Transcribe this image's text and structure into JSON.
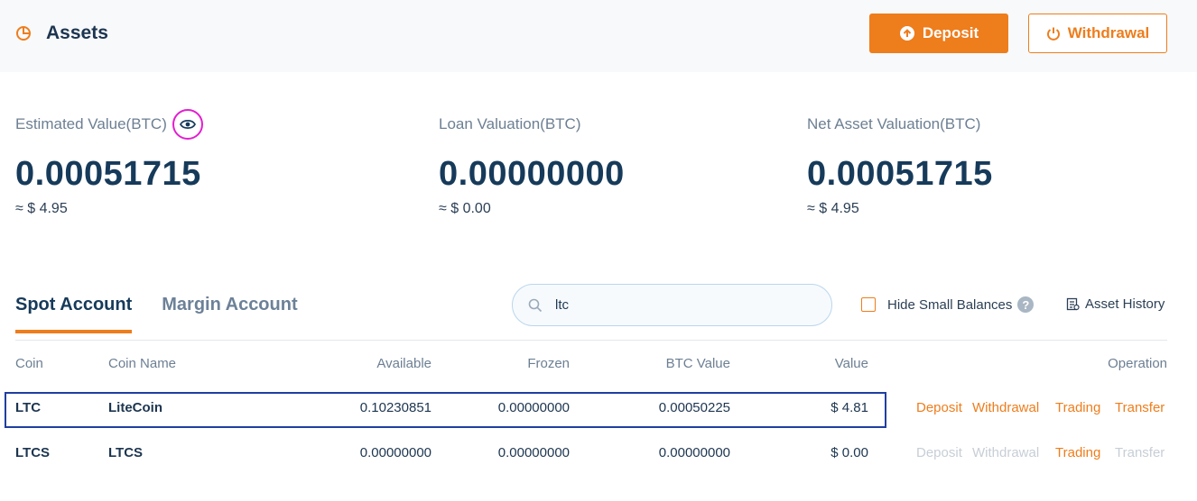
{
  "header": {
    "title": "Assets",
    "deposit_label": "Deposit",
    "withdrawal_label": "Withdrawal"
  },
  "summary": [
    {
      "label": "Estimated Value(BTC)",
      "value": "0.00051715",
      "usd": "≈ $ 4.95"
    },
    {
      "label": "Loan Valuation(BTC)",
      "value": "0.00000000",
      "usd": "≈ $ 0.00"
    },
    {
      "label": "Net Asset Valuation(BTC)",
      "value": "0.00051715",
      "usd": "≈ $ 4.95"
    }
  ],
  "tabs": [
    {
      "label": "Spot Account",
      "active": true
    },
    {
      "label": "Margin Account",
      "active": false
    }
  ],
  "search": {
    "value": "ltc",
    "placeholder": ""
  },
  "filters": {
    "hide_small_label": "Hide Small Balances",
    "help_glyph": "?",
    "asset_history_label": "Asset History"
  },
  "table": {
    "columns": [
      "Coin",
      "Coin Name",
      "Available",
      "Frozen",
      "BTC Value",
      "Value",
      "Operation"
    ],
    "rows": [
      {
        "coin": "LTC",
        "name": "LiteCoin",
        "available": "0.10230851",
        "frozen": "0.00000000",
        "btc_value": "0.00050225",
        "value": "$ 4.81",
        "ops": [
          {
            "label": "Deposit",
            "enabled": true
          },
          {
            "label": "Withdrawal",
            "enabled": true
          },
          {
            "label": "Trading",
            "enabled": true
          },
          {
            "label": "Transfer",
            "enabled": true
          }
        ]
      },
      {
        "coin": "LTCS",
        "name": "LTCS",
        "available": "0.00000000",
        "frozen": "0.00000000",
        "btc_value": "0.00000000",
        "value": "$ 0.00",
        "ops": [
          {
            "label": "Deposit",
            "enabled": false
          },
          {
            "label": "Withdrawal",
            "enabled": false
          },
          {
            "label": "Trading",
            "enabled": true
          },
          {
            "label": "Transfer",
            "enabled": false
          }
        ]
      }
    ]
  },
  "colors": {
    "accent": "#ee7d1c",
    "text_dark": "#163a5a",
    "muted": "#6c7f93",
    "disabled": "#c7ced6",
    "highlight_border": "#1f3fa0",
    "eye_ring": "#e21fd0"
  }
}
